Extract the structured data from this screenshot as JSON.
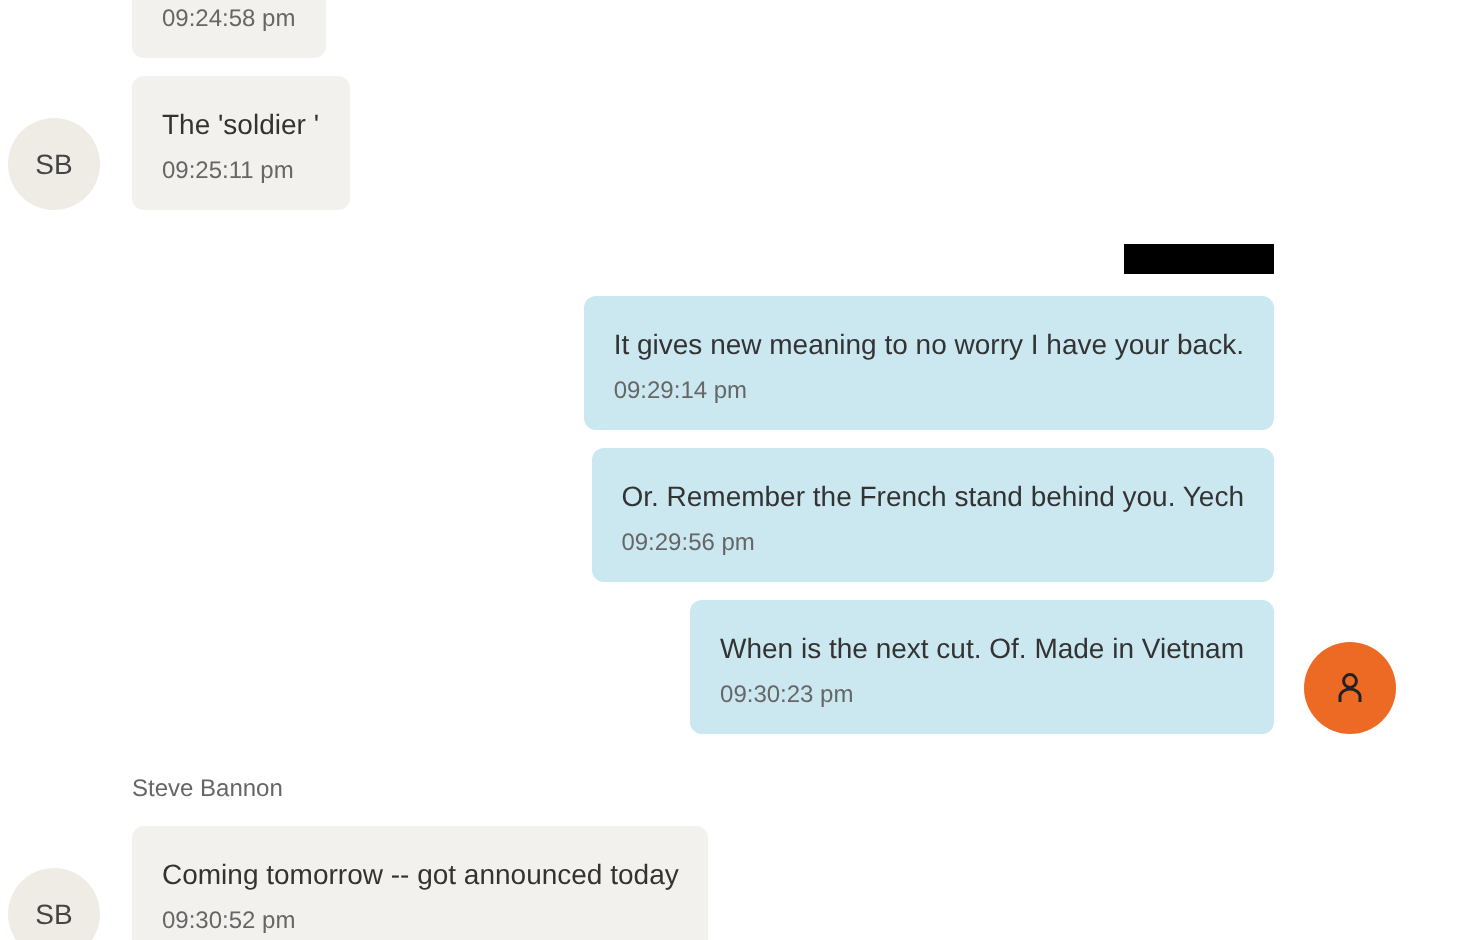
{
  "feed": [
    {
      "kind": "incoming",
      "time": "09:24:58 pm",
      "show_avatar": false
    },
    {
      "kind": "incoming",
      "text": "The 'soldier '",
      "time": "09:25:11 pm",
      "show_avatar": true,
      "initials": "SB"
    },
    {
      "kind": "redacted_name"
    },
    {
      "kind": "outgoing",
      "text": "It gives new meaning to no worry I have your back.",
      "time": "09:29:14 pm",
      "show_avatar": false
    },
    {
      "kind": "outgoing",
      "text": "Or.  Remember the French stand behind you.  Yech",
      "time": "09:29:56 pm",
      "show_avatar": false
    },
    {
      "kind": "outgoing",
      "text": "When is the next cut. Of.   Made in Vietnam",
      "time": "09:30:23 pm",
      "show_avatar": true
    },
    {
      "kind": "sender_name",
      "text": "Steve Bannon"
    },
    {
      "kind": "incoming",
      "text": "Coming tomorrow -- got announced today",
      "time": "09:30:52 pm",
      "show_avatar": true,
      "initials": "SB"
    }
  ]
}
